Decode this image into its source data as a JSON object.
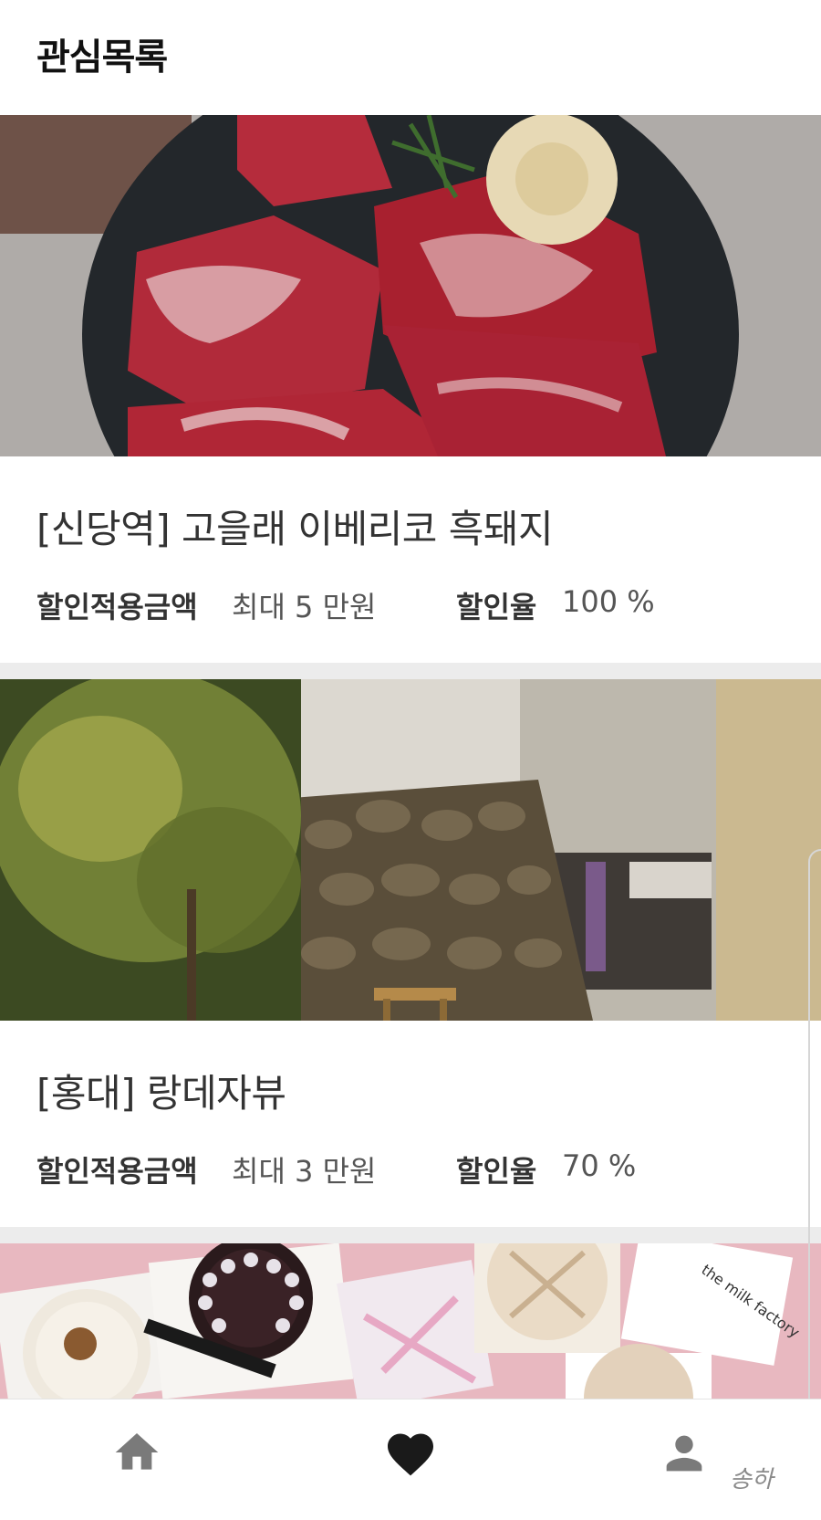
{
  "header": {
    "title": "관심목록"
  },
  "cards": [
    {
      "title": "[신당역] 고을래 이베리코 흑돼지",
      "discount_amount_label": "할인적용금액",
      "discount_amount_value": "최대 5 만원",
      "discount_rate_label": "할인율",
      "discount_rate_value": "100 %"
    },
    {
      "title": "[홍대] 랑데자뷰",
      "discount_amount_label": "할인적용금액",
      "discount_amount_value": "최대 3 만원",
      "discount_rate_label": "할인율",
      "discount_rate_value": "70 %"
    },
    {
      "box_text": "the milk factory"
    }
  ],
  "navbar": {
    "items": [
      {
        "icon": "home-icon"
      },
      {
        "icon": "heart-icon",
        "active": true
      },
      {
        "icon": "person-icon"
      }
    ]
  },
  "watermark": "송하",
  "colors": {
    "active_icon": "#1a1a1a",
    "inactive_icon": "#7a7a7a"
  }
}
